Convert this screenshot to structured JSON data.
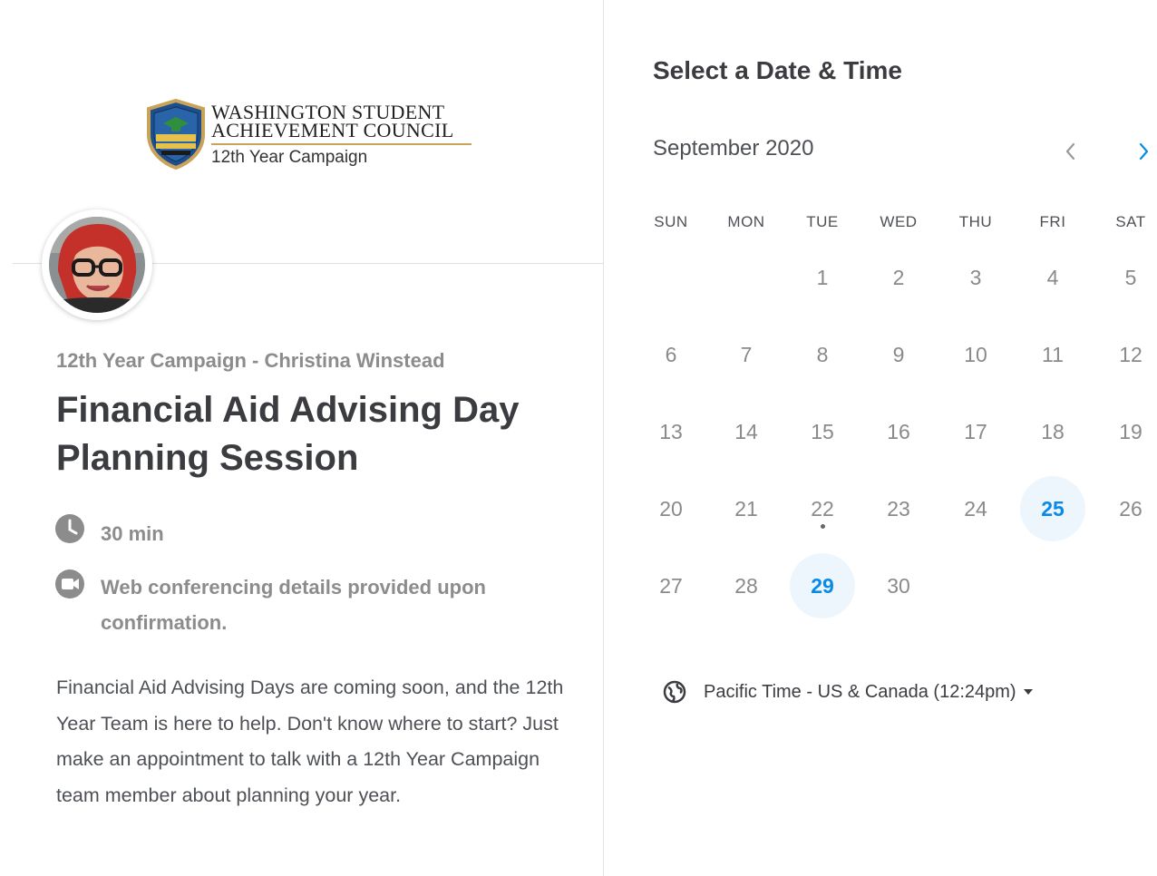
{
  "logo": {
    "line1": "WASHINGTON STUDENT",
    "line2": "ACHIEVEMENT COUNCIL",
    "subtitle": "12th Year Campaign",
    "seal_text": "12th Year Campaign"
  },
  "event": {
    "host": "12th Year Campaign - Christina Winstead",
    "title": "Financial Aid Advising Day Planning Session",
    "duration": "30 min",
    "location": "Web conferencing details provided upon confirmation.",
    "description": "Financial Aid Advising Days are coming soon, and the 12th Year Team is here to help. Don't know where to start? Just make an appointment to talk with a 12th Year Campaign team member about planning your year."
  },
  "scheduler": {
    "title": "Select a Date & Time",
    "month": "September 2020",
    "weekdays": [
      "SUN",
      "MON",
      "TUE",
      "WED",
      "THU",
      "FRI",
      "SAT"
    ],
    "first_weekday_index": 2,
    "days_in_month": 30,
    "available_days": [
      25,
      29
    ],
    "today": 22,
    "timezone": "Pacific Time - US & Canada (12:24pm)"
  },
  "icons": {
    "duration": "clock-icon",
    "location": "video-camera-icon",
    "timezone": "globe-icon",
    "prev": "chevron-left-icon",
    "next": "chevron-right-icon"
  },
  "colors": {
    "accent": "#0a8ae8",
    "available_bg": "#eef6fd",
    "muted_text": "#8c8c8c",
    "heading_text": "#3a3c40",
    "body_text": "#4d5055",
    "logo_rule": "#c9a35a"
  }
}
